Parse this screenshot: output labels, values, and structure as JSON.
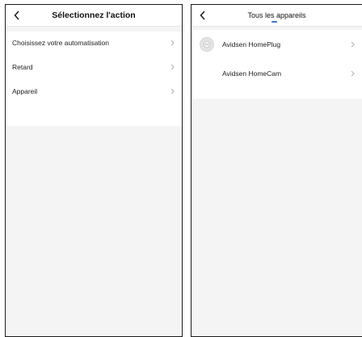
{
  "left_screen": {
    "title": "Sélectionnez l'action",
    "items": [
      {
        "label": "Choisissez votre automatisation"
      },
      {
        "label": "Retard"
      },
      {
        "label": "Appareil"
      }
    ]
  },
  "right_screen": {
    "title": "Tous les appareils",
    "devices": [
      {
        "name": "Avidsen HomePlug",
        "icon": "smart-plug-icon"
      },
      {
        "name": "Avidsen HomeCam",
        "icon": ""
      }
    ]
  },
  "colors": {
    "accent": "#3a78d6",
    "background": "#f4f4f4",
    "surface": "#ffffff"
  }
}
